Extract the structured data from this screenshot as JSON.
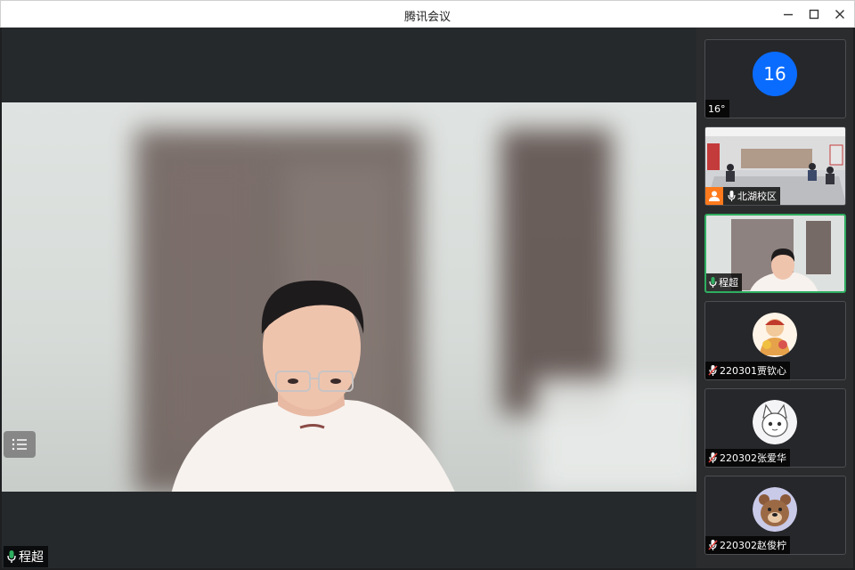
{
  "window": {
    "title": "腾讯会议",
    "controls": [
      "minimize-icon",
      "maximize-icon",
      "close-icon"
    ]
  },
  "main_view": {
    "speaker_name": "程超",
    "mic_status": "mic-on-icon",
    "list_button": "list-icon"
  },
  "participants": [
    {
      "type": "number-avatar",
      "avatar_text": "16",
      "name": "16°",
      "mic": "none"
    },
    {
      "type": "camera",
      "name": "北湖校区",
      "mic": "mic-on-icon",
      "badge": "person-icon"
    },
    {
      "type": "camera",
      "name": "程超",
      "mic": "mic-active-icon",
      "active": true
    },
    {
      "type": "avatar",
      "name": "220301贾钦心",
      "mic": "mic-muted-icon"
    },
    {
      "type": "avatar",
      "name": "220302张爱华",
      "mic": "mic-muted-icon"
    },
    {
      "type": "avatar",
      "name": "220302赵俊柠",
      "mic": "mic-muted-icon"
    }
  ],
  "colors": {
    "speaking_green": "#2fae60",
    "muted_red": "#e0403a",
    "number_avatar_blue": "#0a6cff",
    "person_badge_orange": "#ff7a1c"
  }
}
